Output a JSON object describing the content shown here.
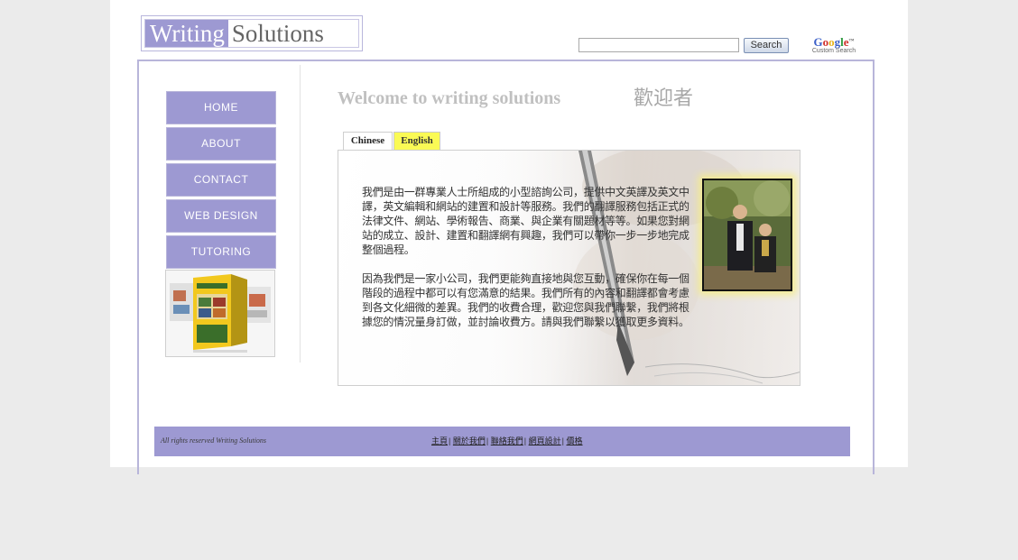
{
  "logo": {
    "part1": "Writing",
    "part2": "Solutions"
  },
  "search": {
    "button_label": "Search",
    "google": "Google",
    "google_tm": "™",
    "google_sub": "Custom Search"
  },
  "nav": [
    {
      "label": "HOME"
    },
    {
      "label": "ABOUT"
    },
    {
      "label": "CONTACT"
    },
    {
      "label": "WEB DESIGN"
    },
    {
      "label": "TUTORING"
    }
  ],
  "main": {
    "welcome_en": "Welcome to writing solutions",
    "welcome_cn": "歡迎者",
    "tabs": [
      {
        "label": "Chinese"
      },
      {
        "label": "English"
      }
    ],
    "paragraph1": "我們是由一群專業人士所組成的小型諮詢公司，提供中文英譯及英文中譯，英文編輯和網站的建置和設計等服務。我們的翻譯服務包括正式的法律文件、網站、學術報告、商業、與企業有關題材等等。如果您對網站的成立、設計、建置和翻譯網有興趣，我們可以帶你一步一步地完成整個過程。",
    "paragraph2": "因為我們是一家小公司，我們更能夠直接地與您互動，確保你在每一個階段的過程中都可以有您滿意的結果。我們所有的內容和翻譯都會考慮到各文化細微的差異。我們的收費合理，歡迎您與我們聯繫，我們將根據您的情況量身訂做，並討論收費方。請與我們聯繫以獲取更多資料。"
  },
  "footer": {
    "copyright": "All rights reserved Writing Solutions",
    "links": [
      "主頁",
      "關於我們",
      "聯絡我們",
      "網頁設計",
      "價格"
    ],
    "separator": "|"
  },
  "colors": {
    "accent": "#9d99d2",
    "english_tab": "#fafa55",
    "border": "#b8b5da"
  }
}
